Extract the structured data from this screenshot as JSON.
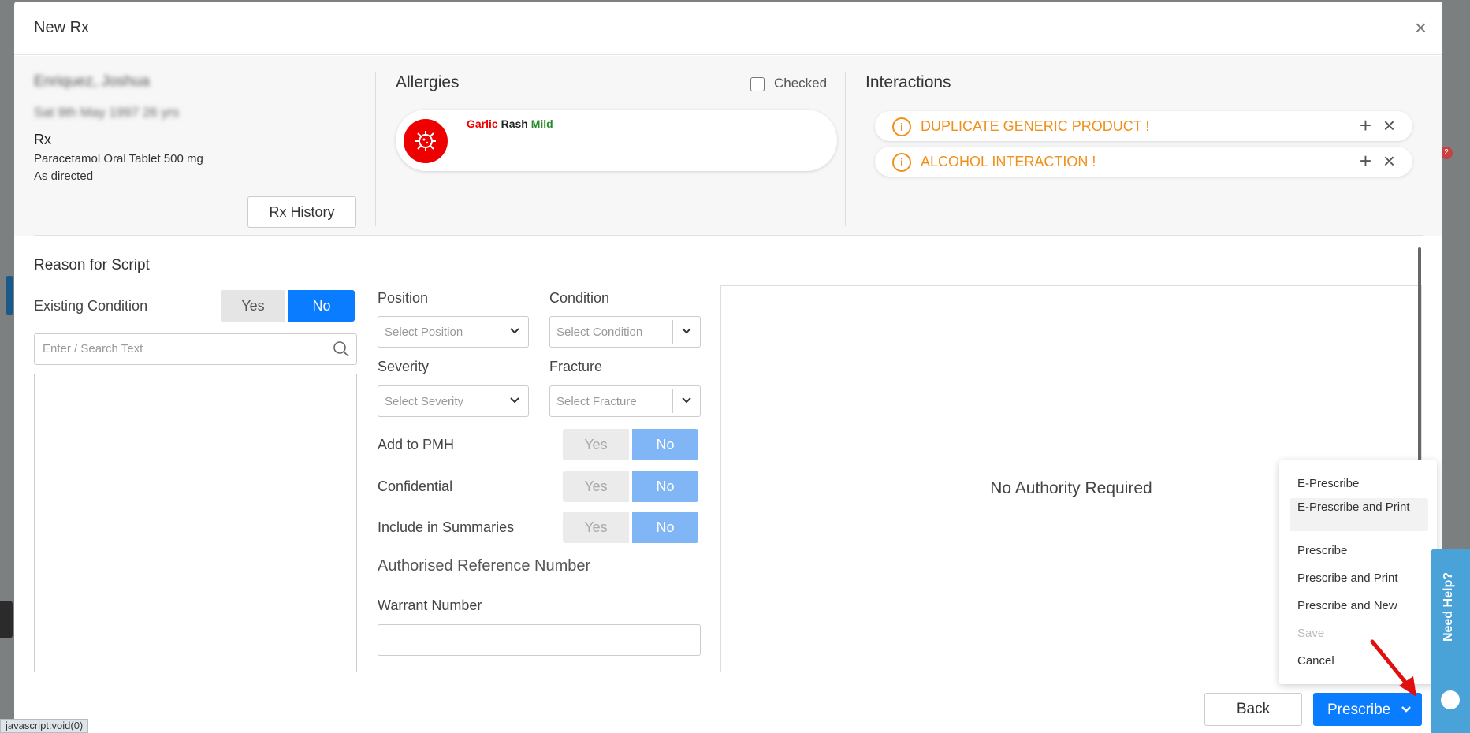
{
  "modal": {
    "title": "New Rx"
  },
  "patient": {
    "name": "Enriquez, Joshua",
    "dob": "Sat 9th May 1997 26 yrs"
  },
  "rx": {
    "label": "Rx",
    "drug": "Paracetamol Oral Tablet 500 mg",
    "direction": "As directed",
    "history_button": "Rx History"
  },
  "allergies": {
    "title": "Allergies",
    "checked_label": "Checked",
    "checked": false,
    "items": [
      {
        "agent": "Garlic",
        "reaction": "Rash",
        "severity": "Mild"
      }
    ]
  },
  "interactions": {
    "title": "Interactions",
    "items": [
      {
        "text": "DUPLICATE GENERIC PRODUCT !"
      },
      {
        "text": "ALCOHOL INTERACTION !"
      }
    ]
  },
  "reason": {
    "title": "Reason for Script",
    "existing_condition_label": "Existing Condition",
    "yes": "Yes",
    "no": "No",
    "search_placeholder": "Enter / Search Text"
  },
  "fields": {
    "position_label": "Position",
    "position_placeholder": "Select Position",
    "condition_label": "Condition",
    "condition_placeholder": "Select Condition",
    "severity_label": "Severity",
    "severity_placeholder": "Select Severity",
    "fracture_label": "Fracture",
    "fracture_placeholder": "Select Fracture"
  },
  "toggles": [
    {
      "label": "Add to PMH",
      "yes": "Yes",
      "no": "No"
    },
    {
      "label": "Confidential",
      "yes": "Yes",
      "no": "No"
    },
    {
      "label": "Include in Summaries",
      "yes": "Yes",
      "no": "No"
    }
  ],
  "authority": {
    "ref_label": "Authorised Reference Number",
    "warrant_label": "Warrant Number",
    "status_text": "No Authority Required"
  },
  "dropdown": {
    "items": [
      {
        "label": "E-Prescribe"
      },
      {
        "label": "E-Prescribe and Print"
      },
      {
        "label": "Prescribe"
      },
      {
        "label": "Prescribe and Print"
      },
      {
        "label": "Prescribe and New"
      },
      {
        "label": "Save"
      },
      {
        "label": "Cancel"
      }
    ]
  },
  "footer": {
    "back": "Back",
    "prescribe": "Prescribe"
  },
  "help": {
    "label": "Need Help?"
  },
  "status_bar": {
    "url": "javascript:void(0)"
  },
  "backdrop": {
    "badge": "2"
  },
  "colors": {
    "primary": "#0a7cff",
    "primary_light": "#80b6f6",
    "allergy_red": "#ee0000",
    "warning_orange": "#f0901a",
    "severity_green": "#2a8a2a",
    "help_blue": "#4aa3d8"
  },
  "icons": {
    "close": "close-icon",
    "allergy": "virus-icon",
    "info": "info-icon",
    "add": "plus-icon",
    "search": "search-icon",
    "chevron": "chevron-down-icon"
  }
}
